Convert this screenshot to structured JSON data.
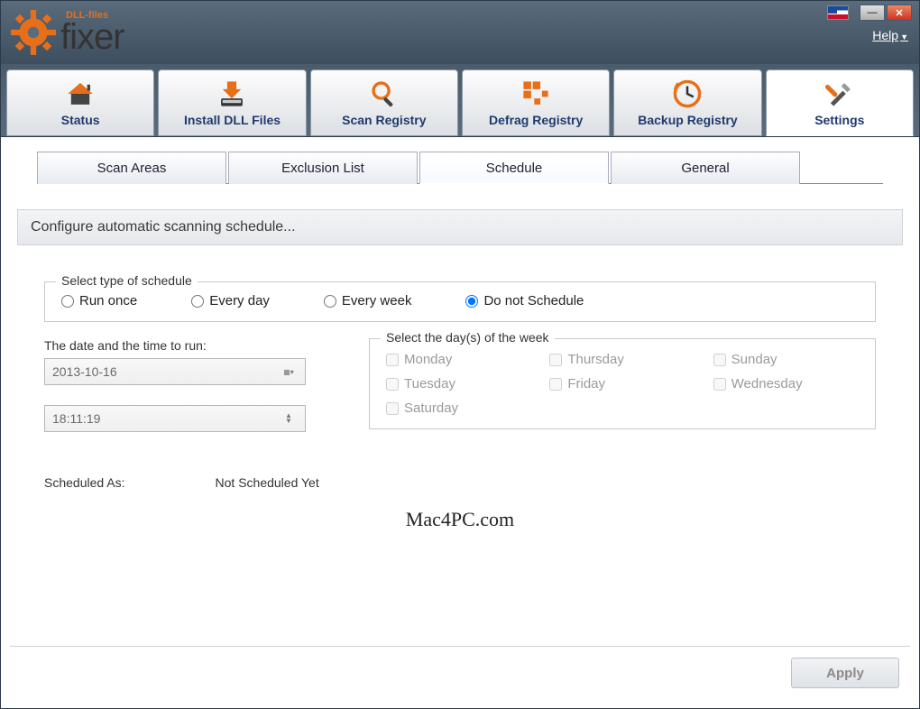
{
  "header": {
    "logo_small": "DLL-files",
    "logo_big": "fixer",
    "help_label": "Help"
  },
  "main_tabs": [
    {
      "label": "Status"
    },
    {
      "label": "Install DLL Files"
    },
    {
      "label": "Scan Registry"
    },
    {
      "label": "Defrag Registry"
    },
    {
      "label": "Backup Registry"
    },
    {
      "label": "Settings"
    }
  ],
  "sub_tabs": [
    {
      "label": "Scan Areas"
    },
    {
      "label": "Exclusion List"
    },
    {
      "label": "Schedule"
    },
    {
      "label": "General"
    }
  ],
  "panel_title": "Configure automatic scanning schedule...",
  "schedule_type": {
    "legend": "Select type of schedule",
    "options": [
      {
        "label": "Run once",
        "checked": false
      },
      {
        "label": "Every day",
        "checked": false
      },
      {
        "label": "Every week",
        "checked": false
      },
      {
        "label": "Do not Schedule",
        "checked": true
      }
    ]
  },
  "datetime": {
    "label": "The date and the time to run:",
    "date_value": "2013-10-16",
    "time_value": "18:11:19"
  },
  "days": {
    "legend": "Select the day(s) of the week",
    "items": [
      "Monday",
      "Thursday",
      "Sunday",
      "Tuesday",
      "Friday",
      "Wednesday",
      "Saturday"
    ]
  },
  "scheduled_as_label": "Scheduled As:",
  "scheduled_as_value": "Not Scheduled Yet",
  "watermark": "Mac4PC.com",
  "apply_label": "Apply"
}
